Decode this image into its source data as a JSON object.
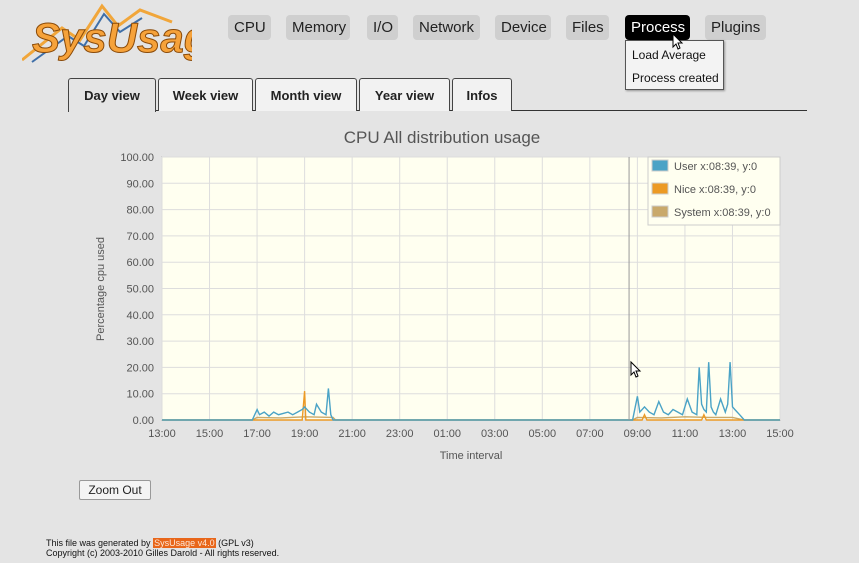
{
  "logo": {
    "text": "SysUsage"
  },
  "nav": {
    "items": [
      "CPU",
      "Memory",
      "I/O",
      "Network",
      "Device",
      "Files",
      "Process",
      "Plugins"
    ],
    "active": "Process",
    "dropdown": [
      "Load Average",
      "Process created"
    ]
  },
  "tabs": [
    "Day view",
    "Week view",
    "Month view",
    "Year view",
    "Infos"
  ],
  "active_tab": "Day view",
  "zoom_out_label": "Zoom Out",
  "footer": {
    "generated_prefix": "This file was generated by",
    "generator_link": "SysUsage v4.0",
    "license": "(GPL v3)",
    "copyright": "Copyright (c) 2003-2010 Gilles Darold - All rights reserved."
  },
  "colors": {
    "user": "#4aa3c6",
    "nice": "#ec9a24",
    "system": "#c9a96b",
    "plot_bg": "#fffff0",
    "grid": "#dddddd"
  },
  "chart_data": {
    "type": "line",
    "title": "CPU All distribution usage",
    "xlabel": "Time interval",
    "ylabel": "Percentage cpu used",
    "ylim": [
      0,
      100
    ],
    "xlim": [
      13.0,
      39.0
    ],
    "yticks": [
      "0.00",
      "10.00",
      "20.00",
      "30.00",
      "40.00",
      "50.00",
      "60.00",
      "70.00",
      "80.00",
      "90.00",
      "100.00"
    ],
    "xticks": [
      "13:00",
      "15:00",
      "17:00",
      "19:00",
      "21:00",
      "23:00",
      "01:00",
      "03:00",
      "05:00",
      "07:00",
      "09:00",
      "11:00",
      "13:00",
      "15:00"
    ],
    "xtick_positions": [
      13,
      15,
      17,
      19,
      21,
      23,
      25,
      27,
      29,
      31,
      33,
      35,
      37,
      39
    ],
    "grid": true,
    "legend_position": "top-right",
    "crosshair": "08:39",
    "series": [
      {
        "name": "User x:08:39, y:0",
        "x": [
          13.0,
          16.8,
          17.0,
          17.1,
          17.3,
          17.5,
          17.7,
          17.9,
          18.1,
          18.3,
          18.5,
          18.7,
          18.9,
          19.0,
          19.2,
          19.4,
          19.5,
          19.7,
          19.9,
          20.0,
          20.1,
          20.2,
          32.8,
          33.0,
          33.1,
          33.3,
          33.5,
          33.7,
          33.9,
          34.1,
          34.3,
          34.5,
          34.7,
          34.9,
          35.1,
          35.3,
          35.5,
          35.6,
          35.7,
          35.8,
          35.9,
          36.0,
          36.1,
          36.2,
          36.3,
          36.5,
          36.7,
          36.8,
          36.9,
          37.0,
          37.1,
          37.3,
          37.5,
          39.0
        ],
        "y": [
          0,
          0,
          4,
          2,
          3,
          1.5,
          3,
          2,
          2.5,
          3,
          2,
          3,
          4,
          5,
          3,
          2,
          6,
          3,
          2,
          12,
          2,
          0,
          0,
          9,
          3,
          5,
          3,
          2,
          7,
          3,
          2,
          4,
          3,
          2,
          8,
          3,
          2,
          20,
          6,
          4,
          3,
          22,
          5,
          3,
          2,
          8,
          3,
          6,
          22,
          5,
          4,
          2,
          0,
          0
        ]
      },
      {
        "name": "Nice x:08:39, y:0",
        "x": [
          13.0,
          18.9,
          19.0,
          19.05,
          19.1,
          33.2,
          33.3,
          33.4,
          35.7,
          35.8,
          35.9,
          39.0
        ],
        "y": [
          0,
          0,
          11,
          0,
          0,
          0,
          2,
          0,
          0,
          2,
          0,
          0
        ]
      },
      {
        "name": "System x:08:39, y:0",
        "x": [
          13.0,
          16.8,
          17.0,
          18.0,
          19.0,
          20.2,
          20.3,
          32.8,
          33.0,
          34.0,
          35.0,
          36.0,
          37.0,
          37.5,
          39.0
        ],
        "y": [
          0,
          0,
          1,
          0.8,
          1.2,
          1,
          0,
          0,
          1,
          0.8,
          1.2,
          1,
          1,
          0,
          0
        ]
      }
    ]
  }
}
